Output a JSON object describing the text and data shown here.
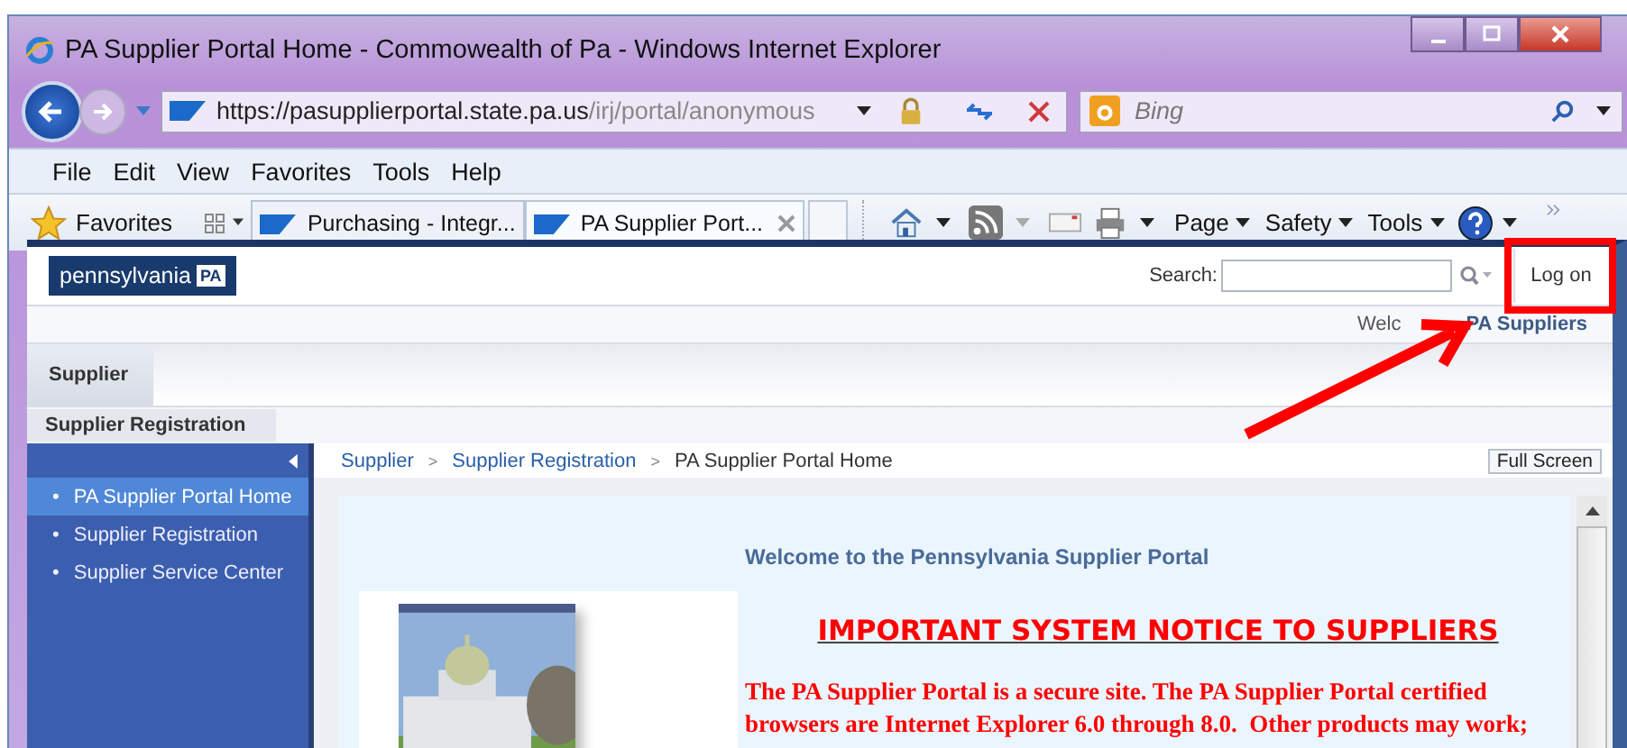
{
  "window": {
    "title": "PA Supplier Portal Home - Commowealth of Pa - Windows Internet Explorer"
  },
  "address_bar": {
    "url_host": "https://pasupplierportal.state.pa.us",
    "url_path": "/irj/portal/anonymous"
  },
  "search_box": {
    "placeholder": "Bing"
  },
  "menu_bar": [
    "File",
    "Edit",
    "View",
    "Favorites",
    "Tools",
    "Help"
  ],
  "favorites": {
    "label": "Favorites"
  },
  "tabs": [
    {
      "label": "Purchasing - Integr...",
      "selected": false
    },
    {
      "label": "PA Supplier Port...",
      "selected": true
    }
  ],
  "command_bar": [
    "Page",
    "Safety",
    "Tools"
  ],
  "portal": {
    "logo": "pennsylvania",
    "logo_badge": "PA",
    "search_label": "Search:",
    "logon": "Log on",
    "welcome_prefix": "Welc",
    "welcome_user": "PA Suppliers",
    "top_tabs": [
      {
        "label": "Supplier",
        "selected": true
      }
    ],
    "sub_tabs": [
      {
        "label": "Supplier Registration",
        "selected": true
      }
    ],
    "nav": [
      {
        "bullet": "•",
        "label": "PA Supplier Portal Home",
        "selected": true
      },
      {
        "bullet": "•",
        "label": "Supplier Registration",
        "selected": false
      },
      {
        "bullet": "•",
        "label": "Supplier Service Center",
        "selected": false
      }
    ],
    "breadcrumb": [
      {
        "kind": "link",
        "text": "Supplier"
      },
      {
        "kind": "separator",
        "text": ">"
      },
      {
        "kind": "link",
        "text": "Supplier Registration"
      },
      {
        "kind": "separator",
        "text": ">"
      },
      {
        "kind": "current",
        "text": "PA Supplier Portal Home"
      }
    ],
    "full_screen": "Full Screen",
    "welcome_heading": "Welcome to the Pennsylvania Supplier Portal",
    "notice_title": "IMPORTANT SYSTEM NOTICE TO SUPPLIERS",
    "notice_lines": [
      "The PA Supplier Portal is a secure site. The PA Supplier Portal certified",
      "browsers are Internet Explorer 6.0 through 8.0.  Other products may work;"
    ]
  }
}
